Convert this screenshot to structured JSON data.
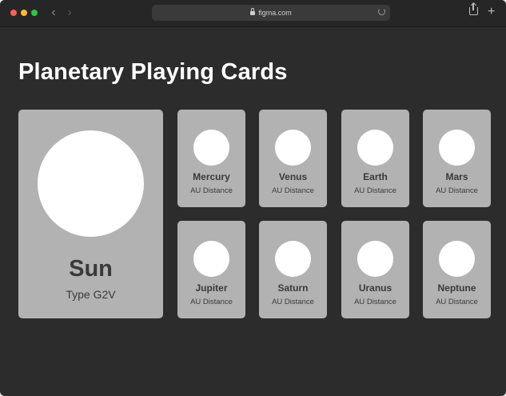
{
  "browser": {
    "url": "figma.com",
    "colors": {
      "close": "#ff5f57",
      "minimize": "#febc2e",
      "zoom": "#28c840"
    }
  },
  "page": {
    "title": "Planetary Playing Cards"
  },
  "sun": {
    "name": "Sun",
    "type": "Type G2V"
  },
  "planets": [
    {
      "name": "Mercury",
      "detail": "AU Distance"
    },
    {
      "name": "Venus",
      "detail": "AU Distance"
    },
    {
      "name": "Earth",
      "detail": "AU Distance"
    },
    {
      "name": "Mars",
      "detail": "AU Distance"
    },
    {
      "name": "Jupiter",
      "detail": "AU Distance"
    },
    {
      "name": "Saturn",
      "detail": "AU Distance"
    },
    {
      "name": "Uranus",
      "detail": "AU Distance"
    },
    {
      "name": "Neptune",
      "detail": "AU Distance"
    }
  ]
}
